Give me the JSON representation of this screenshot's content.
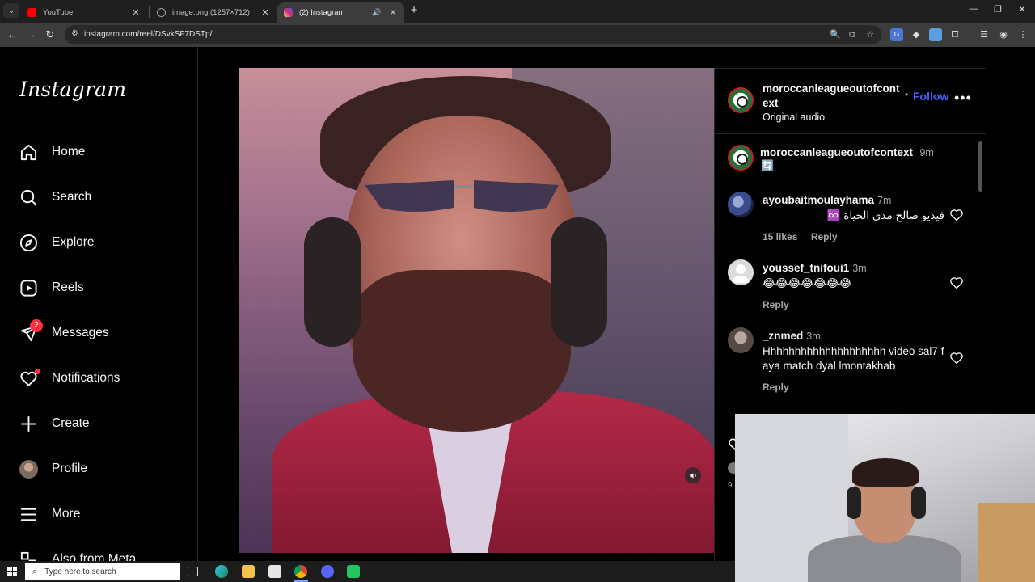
{
  "browser": {
    "tabs": [
      {
        "title": "YouTube",
        "favicon_color": "#ff0000"
      },
      {
        "title": "image.png (1257×712)",
        "favicon_color": "#9aa0a6"
      },
      {
        "title": "(2) Instagram",
        "favicon_color": "#e1306c"
      }
    ],
    "url": "instagram.com/reel/DSvkSF7DSTp/"
  },
  "instagram": {
    "logo": "Instagram",
    "nav": [
      {
        "label": "Home",
        "icon": "home-icon"
      },
      {
        "label": "Search",
        "icon": "search-icon"
      },
      {
        "label": "Explore",
        "icon": "compass-icon"
      },
      {
        "label": "Reels",
        "icon": "reels-icon"
      },
      {
        "label": "Messages",
        "icon": "messenger-icon",
        "badge": "2"
      },
      {
        "label": "Notifications",
        "icon": "heart-icon"
      },
      {
        "label": "Create",
        "icon": "plus-icon"
      },
      {
        "label": "Profile",
        "icon": "avatar"
      },
      {
        "label": "More",
        "icon": "menu-icon"
      },
      {
        "label": "Also from Meta",
        "icon": "meta-icon"
      }
    ],
    "post": {
      "author": "moroccanleagueoutofcont ext",
      "follow": "Follow",
      "separator": "•",
      "audio": "Original audio",
      "caption_user": "moroccanleagueoutofcontext",
      "caption_time": "9m",
      "caption_emoji": "🔄"
    },
    "comments": [
      {
        "user": "ayoubaitmoulayhama",
        "time": "7m",
        "text": "فيديو صالح مدى الحياة ♾️",
        "likes": "15 likes",
        "reply": "Reply"
      },
      {
        "user": "youssef_tnifoui1",
        "time": "3m",
        "text": "😂😂😂😂😂😂😂",
        "likes": "",
        "reply": "Reply"
      },
      {
        "user": "_znmed",
        "time": "3m",
        "text": "Hhhhhhhhhhhhhhhhhhhh video sal7 f aya match dyal lmontakhab",
        "likes": "",
        "reply": "Reply"
      }
    ],
    "partial_count": "9"
  },
  "taskbar": {
    "search_placeholder": "Type here to search"
  },
  "colors": {
    "follow_blue": "#4a5df9",
    "badge_red": "#ff3040"
  }
}
